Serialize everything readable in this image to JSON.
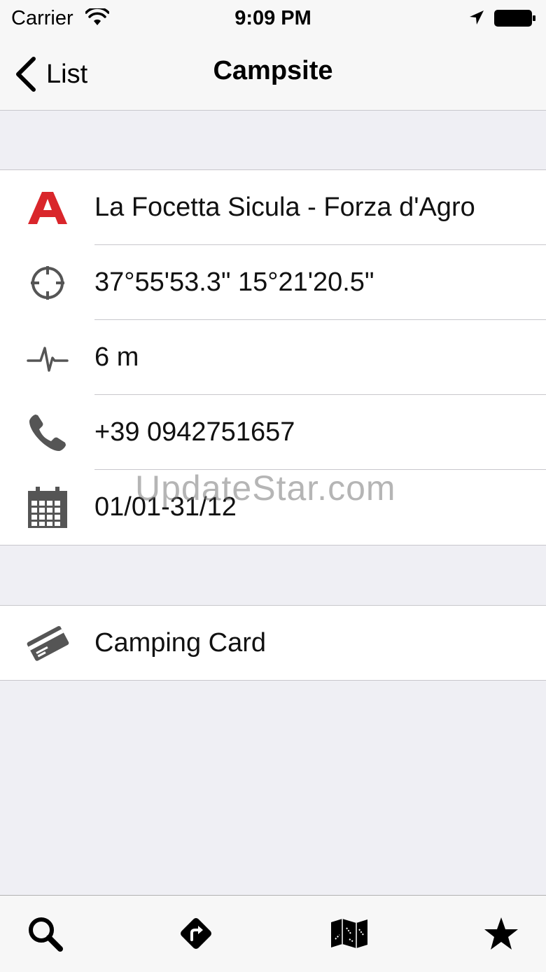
{
  "status_bar": {
    "carrier": "Carrier",
    "time": "9:09 PM"
  },
  "nav": {
    "back_label": "List",
    "title": "Campsite"
  },
  "details": {
    "name": "La Focetta Sicula - Forza d'Agro",
    "coordinates": "37°55'53.3\" 15°21'20.5\"",
    "altitude": "6 m",
    "phone": "+39 0942751657",
    "open_period": "01/01-31/12"
  },
  "extras": {
    "camping_card": "Camping Card"
  },
  "watermark": "UpdateStar.com",
  "colors": {
    "logo_red": "#d9262b",
    "icon_gray": "#555555",
    "background": "#efeff4"
  },
  "tabs": [
    {
      "icon": "search-icon"
    },
    {
      "icon": "route-icon"
    },
    {
      "icon": "map-icon"
    },
    {
      "icon": "star-icon"
    }
  ]
}
